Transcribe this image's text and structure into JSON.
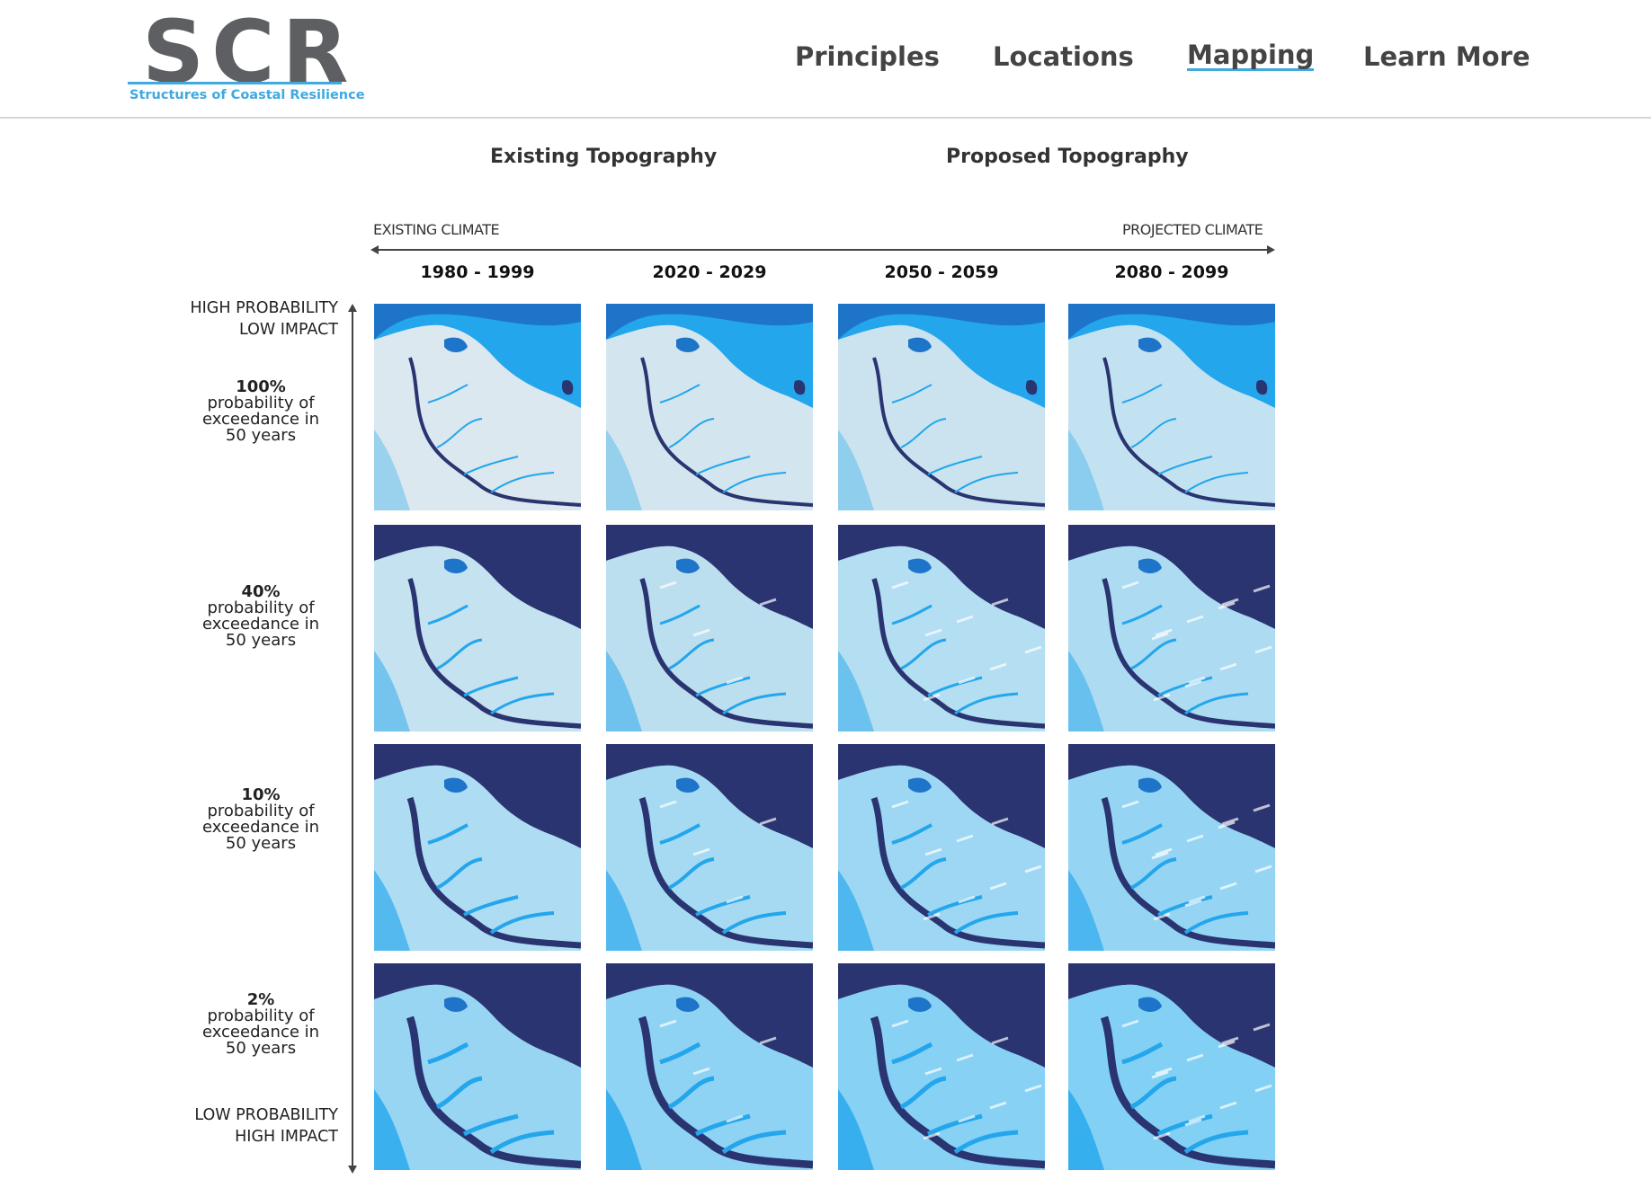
{
  "logo": {
    "mark": "SCR",
    "tagline": "Structures of Coastal Resilience"
  },
  "nav": {
    "items": [
      {
        "label": "Principles"
      },
      {
        "label": "Locations"
      },
      {
        "label": "Mapping"
      },
      {
        "label": "Learn More"
      }
    ]
  },
  "headings": {
    "existing": "Existing Topography",
    "proposed": "Proposed Topography"
  },
  "climate_axis": {
    "start": "EXISTING CLIMATE",
    "end": "PROJECTED CLIMATE"
  },
  "periods": [
    "1980 - 1999",
    "2020 - 2029",
    "2050 - 2059",
    "2080 - 2099"
  ],
  "probability_axis": {
    "top_line1": "HIGH PROBABILITY",
    "top_line2": "LOW IMPACT",
    "bottom_line1": "LOW PROBABILITY",
    "bottom_line2": "HIGH IMPACT"
  },
  "rows": [
    {
      "percent": "100%",
      "line1": "probability of",
      "line2": "exceedance in",
      "line3": "50 years"
    },
    {
      "percent": "40%",
      "line1": "probability of",
      "line2": "exceedance in",
      "line3": "50 years"
    },
    {
      "percent": "10%",
      "line1": "probability of",
      "line2": "exceedance in",
      "line3": "50 years"
    },
    {
      "percent": "2%",
      "line1": "probability of",
      "line2": "exceedance in",
      "line3": "50 years"
    }
  ],
  "colors": {
    "deep_water": "#2a3470",
    "mid_water": "#1e74c8",
    "bright_water": "#23a6ec",
    "flood": "#6fcaf5",
    "land": "#eeeeee",
    "accent": "#3fa9e0"
  }
}
